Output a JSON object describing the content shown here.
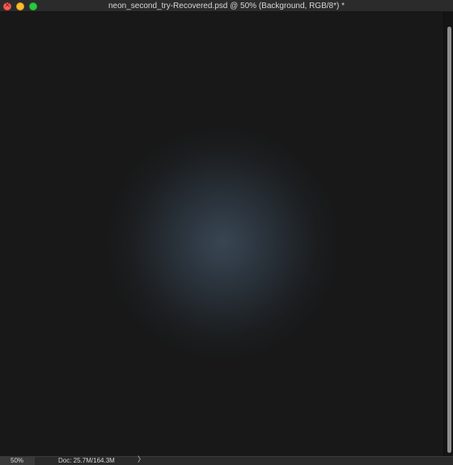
{
  "window": {
    "title": "neon_second_try-Recovered.psd @ 50% (Background, RGB/8*) *"
  },
  "status_bar": {
    "zoom": "50%",
    "doc_info": "Doc: 25.7M/164.3M",
    "arrow_icon": "chevron-right-icon",
    "arrow_glyph": "〉"
  },
  "canvas": {
    "background_color": "#181818",
    "glow_color": "#405262"
  },
  "traffic_lights": {
    "close_color": "#fe5f57",
    "minimize_color": "#febc2e",
    "zoom_color": "#28c840"
  }
}
